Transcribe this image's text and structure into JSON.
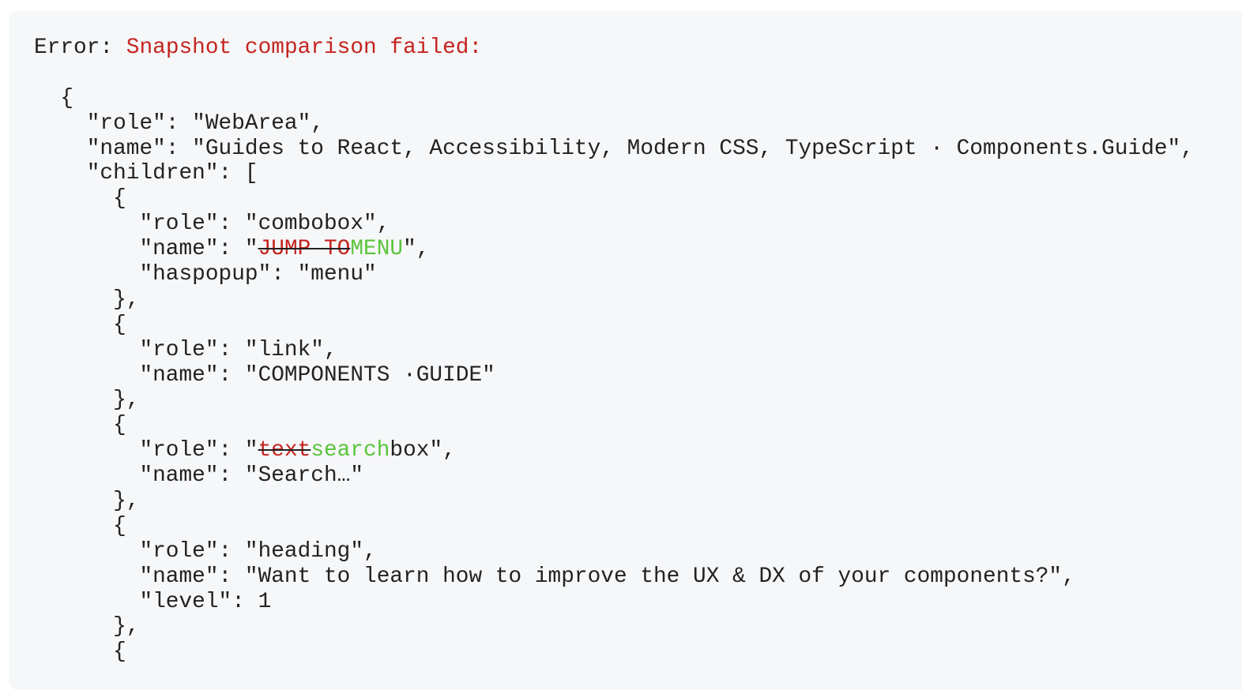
{
  "error": {
    "label": "Error: ",
    "message": "Snapshot comparison failed:"
  },
  "colors": {
    "error": "#c4241f",
    "removed": "#c4241f",
    "added": "#5ac43b",
    "text": "#222222",
    "background": "#f6f7f9"
  },
  "lines": [
    [],
    [
      {
        "t": "n",
        "v": "  {"
      }
    ],
    [
      {
        "t": "n",
        "v": "    \"role\": \"WebArea\","
      }
    ],
    [
      {
        "t": "n",
        "v": "    \"name\": \"Guides to React, Accessibility, Modern CSS, TypeScript · Components.Guide\","
      }
    ],
    [
      {
        "t": "n",
        "v": "    \"children\": ["
      }
    ],
    [
      {
        "t": "n",
        "v": "      {"
      }
    ],
    [
      {
        "t": "n",
        "v": "        \"role\": \"combobox\","
      }
    ],
    [
      {
        "t": "n",
        "v": "        \"name\": \""
      },
      {
        "t": "r",
        "v": "JUMP TO"
      },
      {
        "t": "a",
        "v": "MENU"
      },
      {
        "t": "n",
        "v": "\","
      }
    ],
    [
      {
        "t": "n",
        "v": "        \"haspopup\": \"menu\""
      }
    ],
    [
      {
        "t": "n",
        "v": "      },"
      }
    ],
    [
      {
        "t": "n",
        "v": "      {"
      }
    ],
    [
      {
        "t": "n",
        "v": "        \"role\": \"link\","
      }
    ],
    [
      {
        "t": "n",
        "v": "        \"name\": \"COMPONENTS ·GUIDE\""
      }
    ],
    [
      {
        "t": "n",
        "v": "      },"
      }
    ],
    [
      {
        "t": "n",
        "v": "      {"
      }
    ],
    [
      {
        "t": "n",
        "v": "        \"role\": \""
      },
      {
        "t": "r",
        "v": "text"
      },
      {
        "t": "a",
        "v": "search"
      },
      {
        "t": "n",
        "v": "box\","
      }
    ],
    [
      {
        "t": "n",
        "v": "        \"name\": \"Search…\""
      }
    ],
    [
      {
        "t": "n",
        "v": "      },"
      }
    ],
    [
      {
        "t": "n",
        "v": "      {"
      }
    ],
    [
      {
        "t": "n",
        "v": "        \"role\": \"heading\","
      }
    ],
    [
      {
        "t": "n",
        "v": "        \"name\": \"Want to learn how to improve the UX & DX of your components?\","
      }
    ],
    [
      {
        "t": "n",
        "v": "        \"level\": 1"
      }
    ],
    [
      {
        "t": "n",
        "v": "      },"
      }
    ],
    [
      {
        "t": "n",
        "v": "      {"
      }
    ]
  ]
}
